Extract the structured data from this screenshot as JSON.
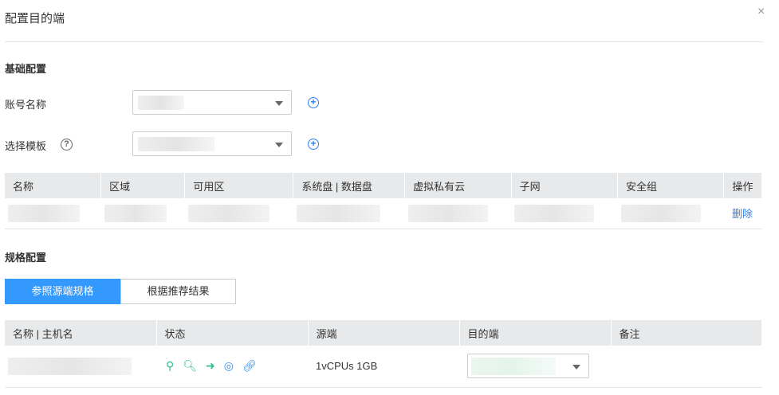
{
  "dialog": {
    "title": "配置目的端",
    "close": "×"
  },
  "basic": {
    "title": "基础配置",
    "account_label": "账号名称",
    "template_label": "选择模板",
    "help": "?",
    "plus": "+"
  },
  "target_table": {
    "headers": [
      "名称",
      "区域",
      "可用区",
      "系统盘 | 数据盘",
      "虚拟私有云",
      "子网",
      "安全组",
      "操作"
    ],
    "delete": "删除"
  },
  "spec": {
    "title": "规格配置",
    "tabs": [
      "参照源端规格",
      "根据推荐结果"
    ],
    "headers": [
      "名称 | 主机名",
      "状态",
      "源端",
      "目的端",
      "备注"
    ],
    "row": {
      "source": "1vCPUs 1GB",
      "icons": [
        "key-icon",
        "search-icon",
        "arrow-right-icon",
        "monitor-icon",
        "link-icon"
      ]
    }
  },
  "colors": {
    "accent": "#3399ff",
    "status_green": "#2ebf91"
  }
}
